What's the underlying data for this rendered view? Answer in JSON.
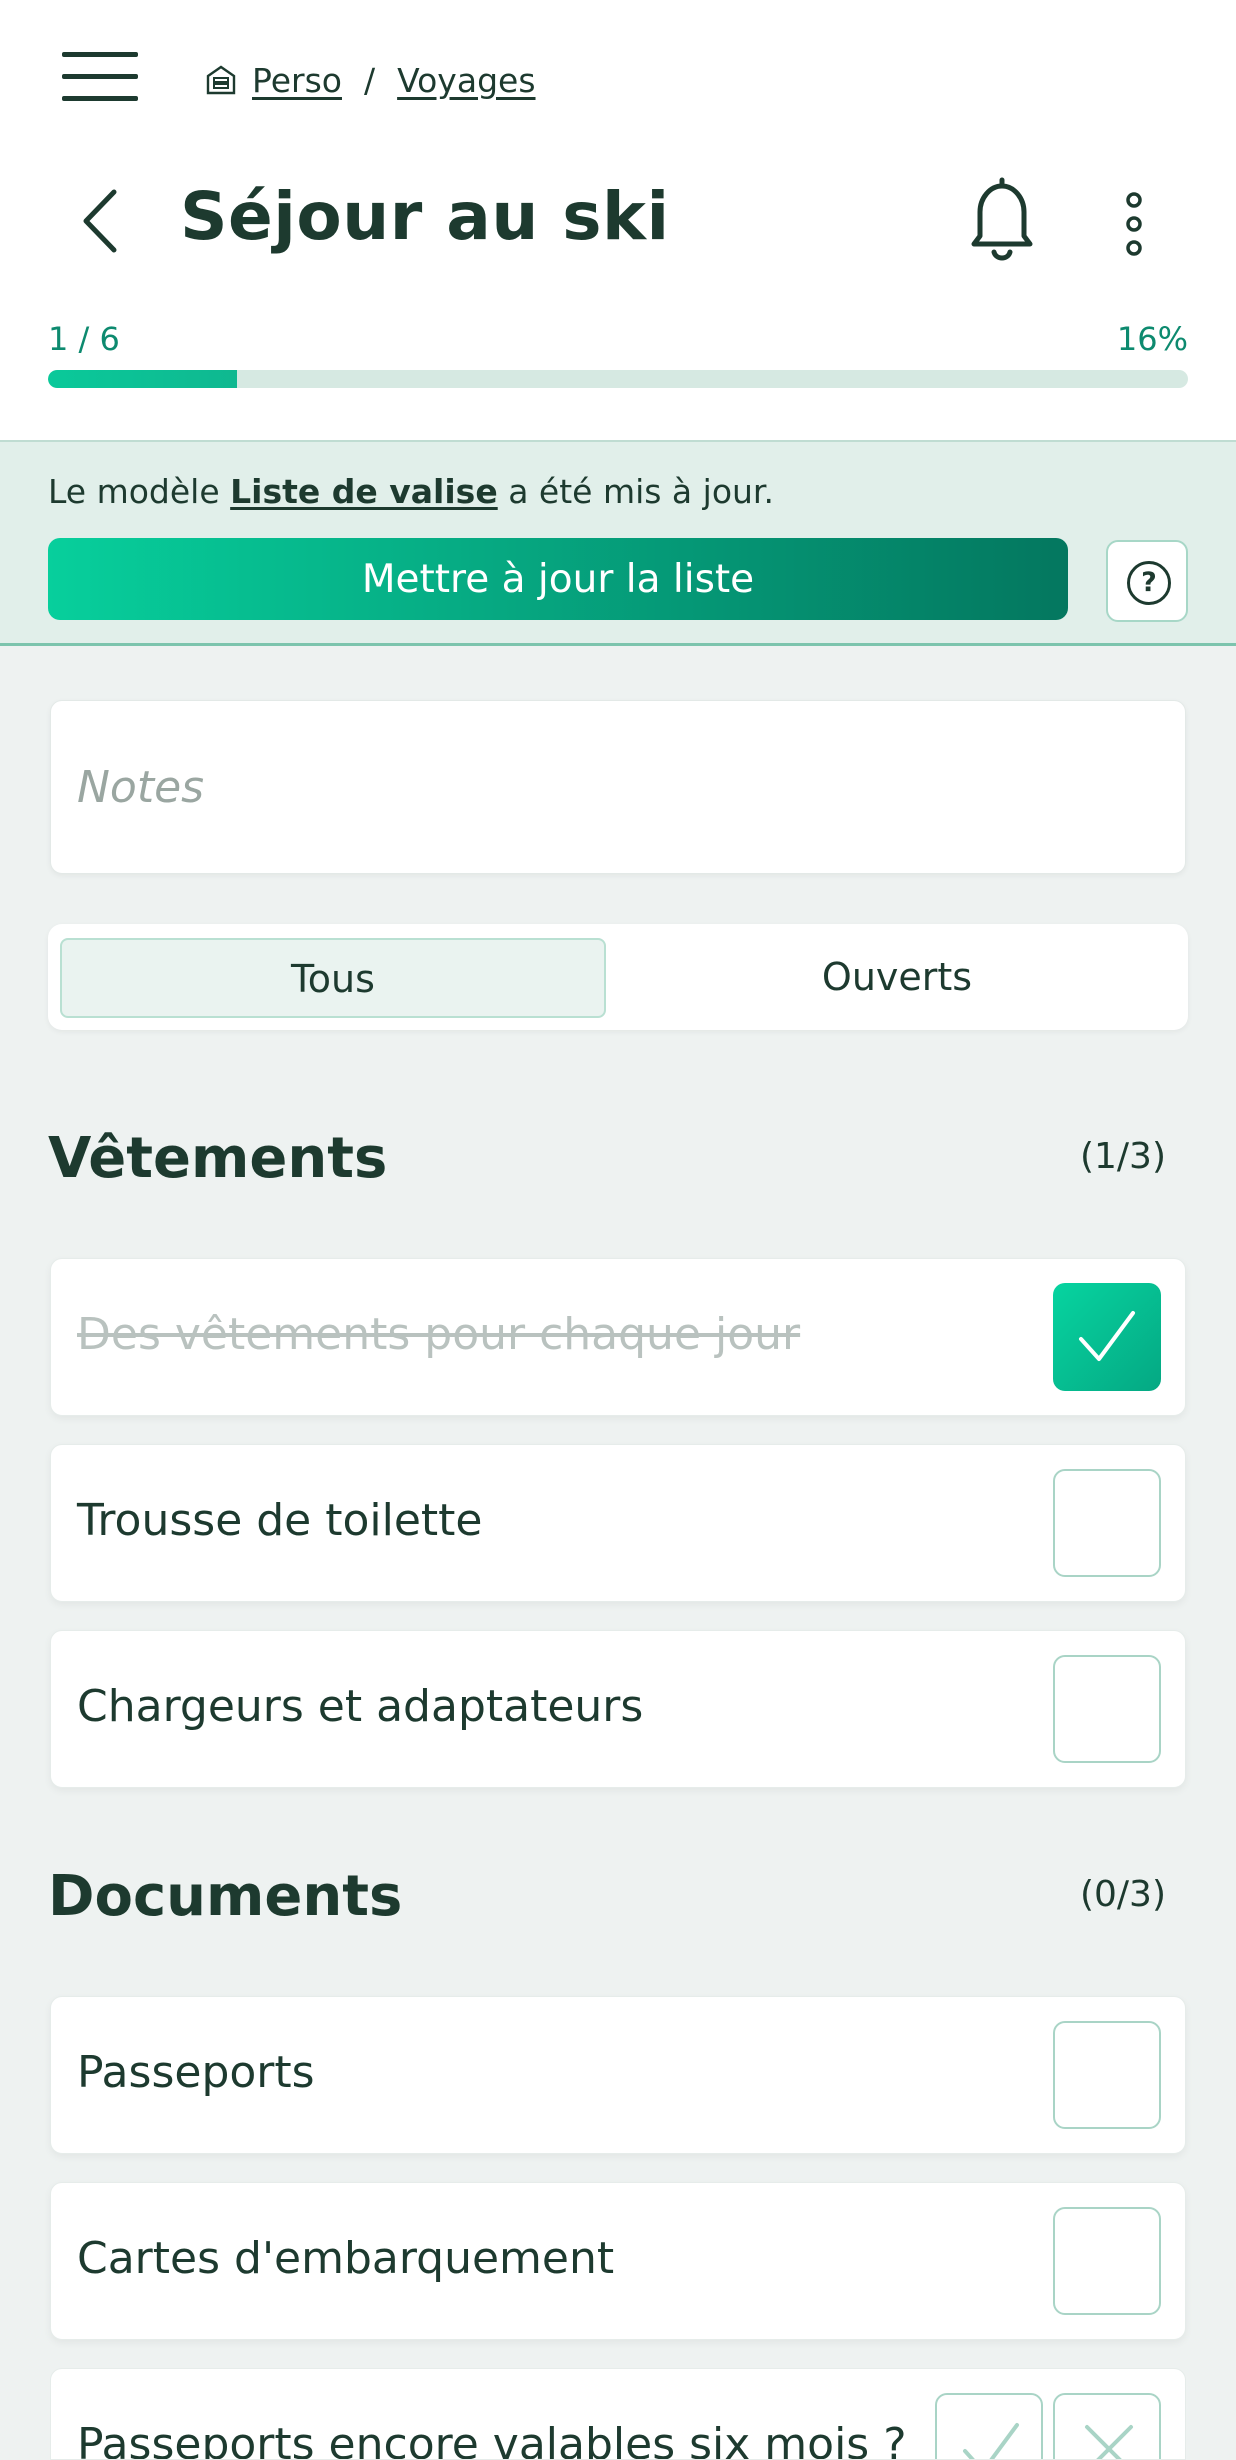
{
  "breadcrumb": {
    "home": "Perso",
    "separator": "/",
    "current": "Voyages"
  },
  "page": {
    "title": "Séjour au ski"
  },
  "progress": {
    "count": "1 / 6",
    "percent_label": "16%",
    "fraction": 0.166
  },
  "banner": {
    "text_before": "Le modèle ",
    "template_name": "Liste de valise",
    "text_after": " a été mis à jour.",
    "update_button": "Mettre à jour la liste",
    "help": "?"
  },
  "notes": {
    "placeholder": "Notes",
    "value": ""
  },
  "filter": {
    "all": "Tous",
    "open": "Ouverts",
    "selected": "Tous"
  },
  "sections": [
    {
      "title": "Vêtements",
      "count": "(1/3)",
      "items": [
        {
          "label": "Des vêtements pour chaque jour",
          "checked": true
        },
        {
          "label": "Trousse de toilette",
          "checked": false
        },
        {
          "label": "Chargeurs et adaptateurs",
          "checked": false
        }
      ]
    },
    {
      "title": "Documents",
      "count": "(0/3)",
      "items": [
        {
          "label": "Passeports",
          "checked": false
        },
        {
          "label": "Cartes d'embarquement",
          "checked": false
        },
        {
          "label": "Passeports encore valables six mois ?",
          "checked": false
        }
      ]
    }
  ],
  "colors": {
    "accent": "#07cf9c",
    "accent_dark": "#04775f",
    "text": "#1d3a2f",
    "progress_track": "#d6e9e2"
  },
  "icons": [
    "menu-icon",
    "home-icon",
    "back-arrow-icon",
    "bell-icon",
    "more-vertical-icon",
    "help-icon",
    "checkmark-icon",
    "cross-icon"
  ]
}
